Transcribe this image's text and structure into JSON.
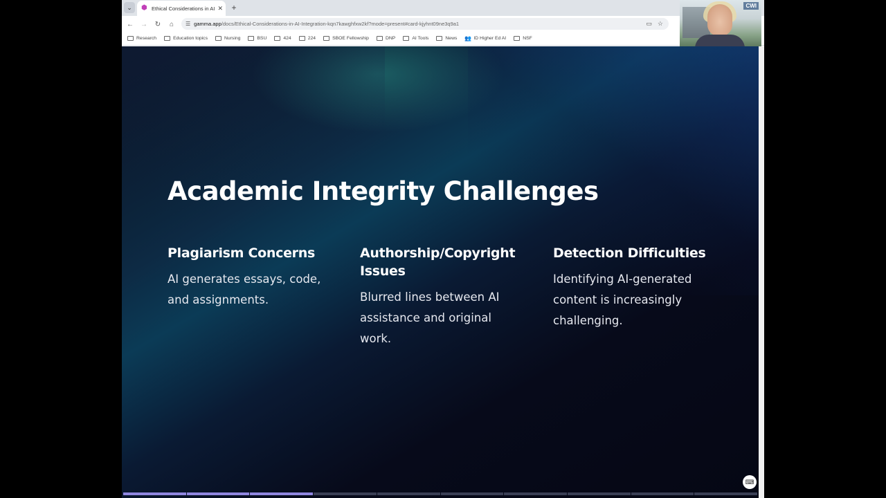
{
  "browser": {
    "tab": {
      "title": "Ethical Considerations in AI Integ",
      "close_glyph": "✕"
    },
    "new_tab_glyph": "+",
    "menu_glyph": "⌄",
    "address": {
      "domain": "gamma.app",
      "path": "/docs/Ethical-Considerations-in-AI-Integration-kqn7kawghfxw2kf?mode=present#card-kjyhnt09ne3q9a1"
    },
    "nav": {
      "back": "←",
      "forward": "→",
      "reload": "↻",
      "home": "⌂"
    },
    "bookmarks": [
      {
        "label": "Research",
        "type": "folder"
      },
      {
        "label": "Education topics",
        "type": "folder"
      },
      {
        "label": "Nursing",
        "type": "folder"
      },
      {
        "label": "BSU",
        "type": "folder"
      },
      {
        "label": "424",
        "type": "folder"
      },
      {
        "label": "224",
        "type": "folder"
      },
      {
        "label": "SBOE Fellowship",
        "type": "folder"
      },
      {
        "label": "DNP",
        "type": "folder"
      },
      {
        "label": "AI Tools",
        "type": "folder"
      },
      {
        "label": "News",
        "type": "folder"
      },
      {
        "label": "ID Higher Ed AI",
        "type": "people"
      },
      {
        "label": "NSF",
        "type": "folder"
      }
    ]
  },
  "slide": {
    "title": "Academic Integrity Challenges",
    "columns": [
      {
        "heading": "Plagiarism Concerns",
        "body": "AI generates essays, code, and assignments."
      },
      {
        "heading": "Authorship/Copyright Issues",
        "body": "Blurred lines between AI assistance and original work."
      },
      {
        "heading": "Detection Difficulties",
        "body": "Identifying AI-generated content is increasingly challenging."
      }
    ],
    "progress": {
      "total_segments": 10,
      "completed_segments": 3
    }
  },
  "webcam": {
    "logo": "CWI"
  },
  "colors": {
    "slide_bg": "#070a1a",
    "progress_done": "#8f86e0",
    "progress_todo": "#3a3f55",
    "text": "#ffffff"
  }
}
